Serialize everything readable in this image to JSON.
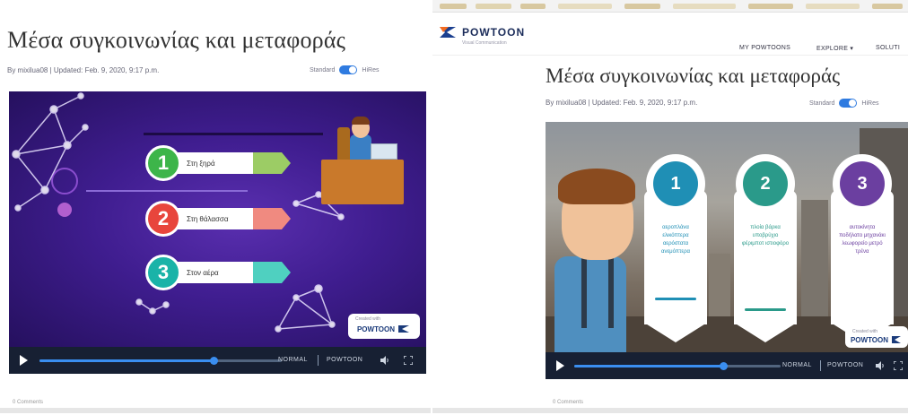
{
  "left": {
    "title": "Μέσα συγκοινωνίας και μεταφοράς",
    "meta": "By mixilua08  |  Updated: Feb. 9, 2020, 9:17 p.m.",
    "toggle_off_label": "Standard",
    "toggle_on_label": "HiRes",
    "items": [
      {
        "number": "1",
        "label": "Στη ξηρά",
        "color": "#3db54a"
      },
      {
        "number": "2",
        "label": "Στη θάλασσα",
        "color": "#e8453c"
      },
      {
        "number": "3",
        "label": "Στον αέρα",
        "color": "#1ab3a8"
      }
    ],
    "logo": {
      "small": "Created with",
      "name": "POWTOON"
    },
    "controls": {
      "progress": 0.72,
      "speed_label": "NORMAL",
      "brand_label": "POWTOON"
    },
    "footer": "0 Comments"
  },
  "right": {
    "brand": "POWTOON",
    "brand_sub": "Visual Communication",
    "nav": [
      "MY POWTOONS",
      "EXPLORE ▾",
      "SOLUTI"
    ],
    "title": "Μέσα συγκοινωνίας και μεταφοράς",
    "meta": "By mixilua08  |  Updated: Feb. 9, 2020, 9:17 p.m.",
    "toggle_off_label": "Standard",
    "toggle_on_label": "HiRes",
    "banners": [
      {
        "number": "1",
        "color": "#1f8fb5",
        "text": "αεροπλάνα ελικόπτερα αερόστατα ανεμόπτερα",
        "text_color": "#1f8fb5"
      },
      {
        "number": "2",
        "color": "#2a9a8a",
        "text": "πλοία βάρκα υποβρύχιο φέριμποτ ιστιοφόρο",
        "text_color": "#2a9a8a"
      },
      {
        "number": "3",
        "color": "#6b3fa0",
        "text": "αυτοκίνητα ποδήλατο μηχανάκι λεωφορείο μετρό τρένα",
        "text_color": "#6b3fa0"
      }
    ],
    "logo": {
      "small": "Created with",
      "name": "POWTOON"
    },
    "controls": {
      "progress": 0.72,
      "speed_label": "NORMAL",
      "brand_label": "POWTOON"
    },
    "footer": "0 Comments"
  }
}
